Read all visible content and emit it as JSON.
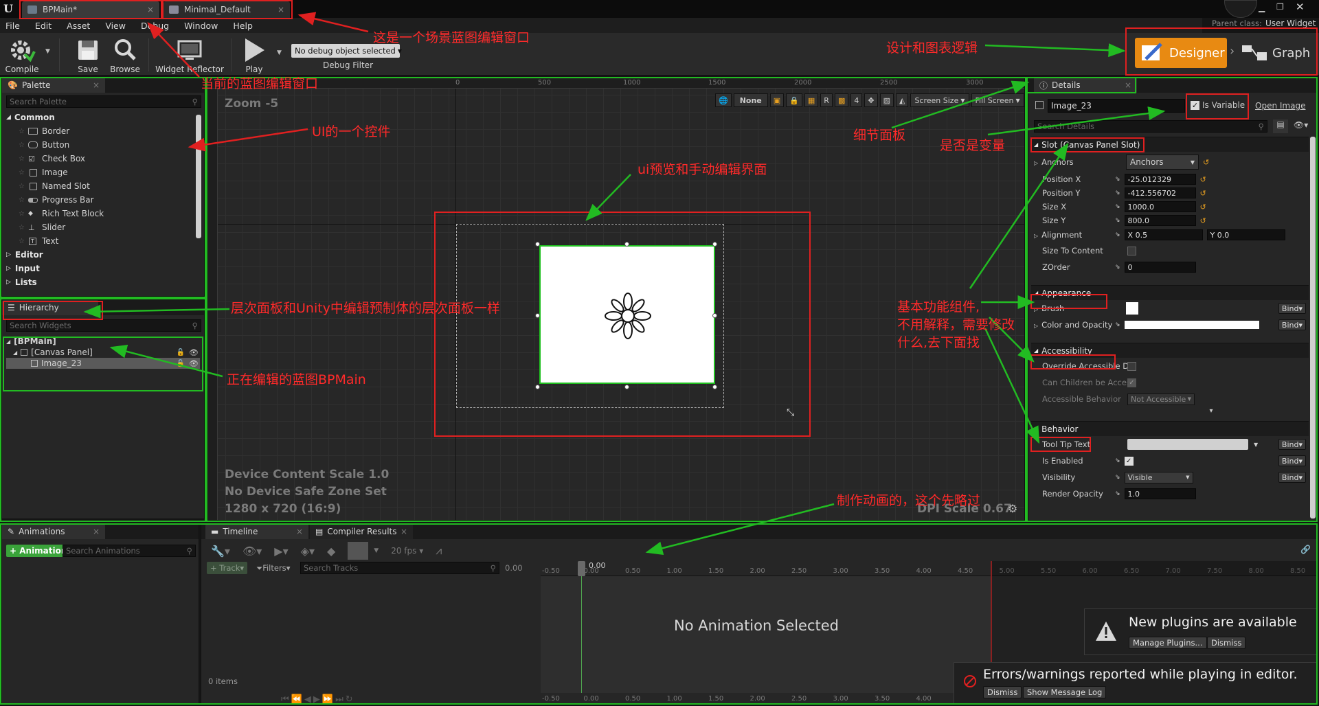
{
  "window": {
    "tabs": [
      "BPMain*",
      "Minimal_Default"
    ],
    "parent_class_label": "Parent class:",
    "parent_class_value": "User Widget"
  },
  "menu": [
    "File",
    "Edit",
    "Asset",
    "View",
    "Debug",
    "Window",
    "Help"
  ],
  "toolbar": {
    "compile": "Compile",
    "save": "Save",
    "browse": "Browse",
    "widget_reflector": "Widget Reflector",
    "play": "Play",
    "debug_select": "No debug object selected",
    "debug_filter": "Debug Filter"
  },
  "modes": {
    "designer": "Designer",
    "graph": "Graph"
  },
  "palette": {
    "title": "Palette",
    "search_placeholder": "Search Palette",
    "common": "Common",
    "items": [
      "Border",
      "Button",
      "Check Box",
      "Image",
      "Named Slot",
      "Progress Bar",
      "Rich Text Block",
      "Slider",
      "Text"
    ],
    "categories": [
      "Editor",
      "Input",
      "Lists"
    ]
  },
  "hierarchy": {
    "title": "Hierarchy",
    "search_placeholder": "Search Widgets",
    "root": "[BPMain]",
    "canvas": "[Canvas Panel]",
    "image": "Image_23"
  },
  "viewport": {
    "zoom": "Zoom -5",
    "none_label": "None",
    "grid_num": "4",
    "r_label": "R",
    "screen_size": "Screen Size",
    "fill_screen": "Fill Screen",
    "ruler": [
      "0",
      "500",
      "1000",
      "1500",
      "2000",
      "2500",
      "3000"
    ],
    "device_scale": "Device Content Scale 1.0",
    "safe_zone": "No Device Safe Zone Set",
    "resolution": "1280 x 720 (16:9)",
    "dpi": "DPI Scale 0.67"
  },
  "details": {
    "title": "Details",
    "name": "Image_23",
    "is_variable": "Is Variable",
    "open_image": "Open Image",
    "search_placeholder": "Search Details",
    "slot_section": "Slot (Canvas Panel Slot)",
    "anchors_label": "Anchors",
    "anchors_value": "Anchors",
    "position_x_label": "Position X",
    "position_x": "-25.012329",
    "position_y_label": "Position Y",
    "position_y": "-412.556702",
    "size_x_label": "Size X",
    "size_x": "1000.0",
    "size_y_label": "Size Y",
    "size_y": "800.0",
    "alignment_label": "Alignment",
    "alignment_x": "X 0.5",
    "alignment_y": "Y 0.0",
    "size_to_content": "Size To Content",
    "zorder_label": "ZOrder",
    "zorder": "0",
    "appearance_section": "Appearance",
    "brush": "Brush",
    "color_opacity": "Color and Opacity",
    "bind": "Bind",
    "accessibility_section": "Accessibility",
    "override_access": "Override Accessible Defa",
    "can_children": "Can Children be Accessi",
    "access_behavior": "Accessible Behavior",
    "not_accessible": "Not Accessible",
    "behavior_section": "Behavior",
    "tooltip": "Tool Tip Text",
    "is_enabled": "Is Enabled",
    "visibility_label": "Visibility",
    "visibility_value": "Visible",
    "render_opacity_label": "Render Opacity",
    "render_opacity": "1.0"
  },
  "animations": {
    "title": "Animations",
    "add_button": "+ Animation",
    "search_placeholder": "Search Animations"
  },
  "timeline": {
    "tabs": [
      "Timeline",
      "Compiler Results"
    ],
    "fps": "20 fps",
    "track": "+ Track",
    "filters": "Filters",
    "search_placeholder": "Search Tracks",
    "time_value": "0.00",
    "playhead": "0.00",
    "ticks": [
      "-0.50",
      "0.00",
      "0.50",
      "1.00",
      "1.50",
      "2.00",
      "2.50",
      "3.00",
      "3.50",
      "4.00",
      "4.50",
      "5.00",
      "5.50",
      "6.00",
      "6.50",
      "7.00",
      "7.50",
      "8.00",
      "8.50"
    ],
    "bottom_ticks": [
      "-0.50",
      "0.00",
      "0.50",
      "1.00",
      "1.50",
      "2.00",
      "2.50",
      "3.00",
      "3.50",
      "4.00"
    ],
    "no_animation": "No Animation Selected",
    "items_count": "0 items"
  },
  "notifications": {
    "plugins_title": "New plugins are available",
    "manage_plugins": "Manage Plugins...",
    "dismiss": "Dismiss",
    "errors_title": "Errors/warnings reported while playing in editor.",
    "show_log": "Show Message Log"
  },
  "annotations": {
    "scene_bp_window": "这是一个场景蓝图编辑窗口",
    "current_bp_window": "当前的蓝图编辑窗口",
    "designer_graph": "设计和图表逻辑",
    "ui_control": "UI的一个控件",
    "ui_preview": "ui预览和手动编辑界面",
    "details_panel": "细节面板",
    "is_variable": "是否是变量",
    "hierarchy_panel": "层次面板和Unity中编辑预制体的层次面板一样",
    "editing_bp": "正在编辑的蓝图BPMain",
    "basic_components_1": "基本功能组件,",
    "basic_components_2": "不用解释，需要修改",
    "basic_components_3": "什么,去下面找",
    "animations": "制作动画的，这个先略过"
  },
  "colors": {
    "annotation_red": "#e02020",
    "annotation_green": "#22bb22",
    "designer_orange": "#e88a12",
    "selection_green": "#1fbf1f"
  }
}
